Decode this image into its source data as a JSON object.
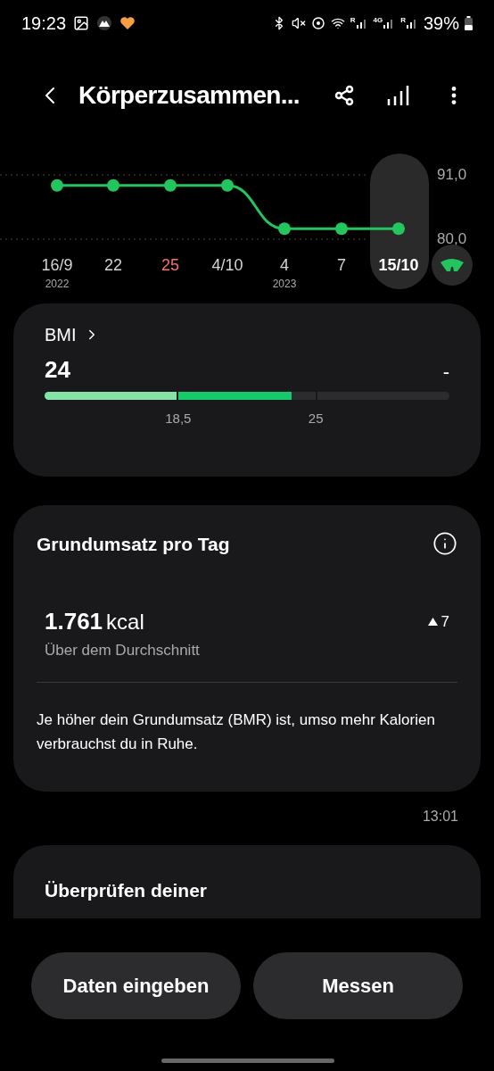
{
  "status_bar": {
    "time": "19:23",
    "signal_labels": [
      "R",
      "4G",
      "R"
    ],
    "battery": "39%"
  },
  "header": {
    "title": "Körperzusammen..."
  },
  "chart": {
    "chart_data": {
      "type": "line",
      "categories": [
        "16/9",
        "22",
        "25",
        "4/10",
        "4",
        "7",
        "15/10"
      ],
      "yticks": [
        {
          "value": 91,
          "label": "91,0"
        },
        {
          "value": 80,
          "label": "80,0"
        }
      ],
      "ylim": [
        80,
        91
      ],
      "series": [
        {
          "color": "#22c55e",
          "marker": "o",
          "values": [
            89.2,
            89.2,
            89.2,
            89.2,
            81.8,
            81.8,
            81.8
          ]
        }
      ]
    },
    "date_axis": [
      {
        "year": "2022",
        "color": "#d4d4d4",
        "selected": false
      },
      {
        "color": "#d4d4d4",
        "selected": false
      },
      {
        "color": "#f87171",
        "selected": false
      },
      {
        "color": "#d4d4d4",
        "selected": false
      },
      {
        "year": "2023",
        "color": "#d4d4d4",
        "selected": false
      },
      {
        "color": "#d4d4d4",
        "selected": false
      },
      {
        "color": "#ffffff",
        "selected": true
      }
    ]
  },
  "bmi": {
    "label": "BMI",
    "value": "24",
    "trend": "-",
    "level": 0.61,
    "markers": [
      "18,5",
      "25"
    ]
  },
  "bmr": {
    "title": "Grundumsatz pro Tag",
    "value": "1.761",
    "unit": "kcal",
    "status": "Über dem Durchschnitt",
    "change": "7",
    "description": "Je höher dein Grundumsatz (BMR) ist, umso mehr Kalorien verbrauchst du in Ruhe.",
    "time": "13:01"
  },
  "check": {
    "title": "Überprüfen deiner"
  },
  "buttons": [
    "Daten eingeben",
    "Messen"
  ]
}
